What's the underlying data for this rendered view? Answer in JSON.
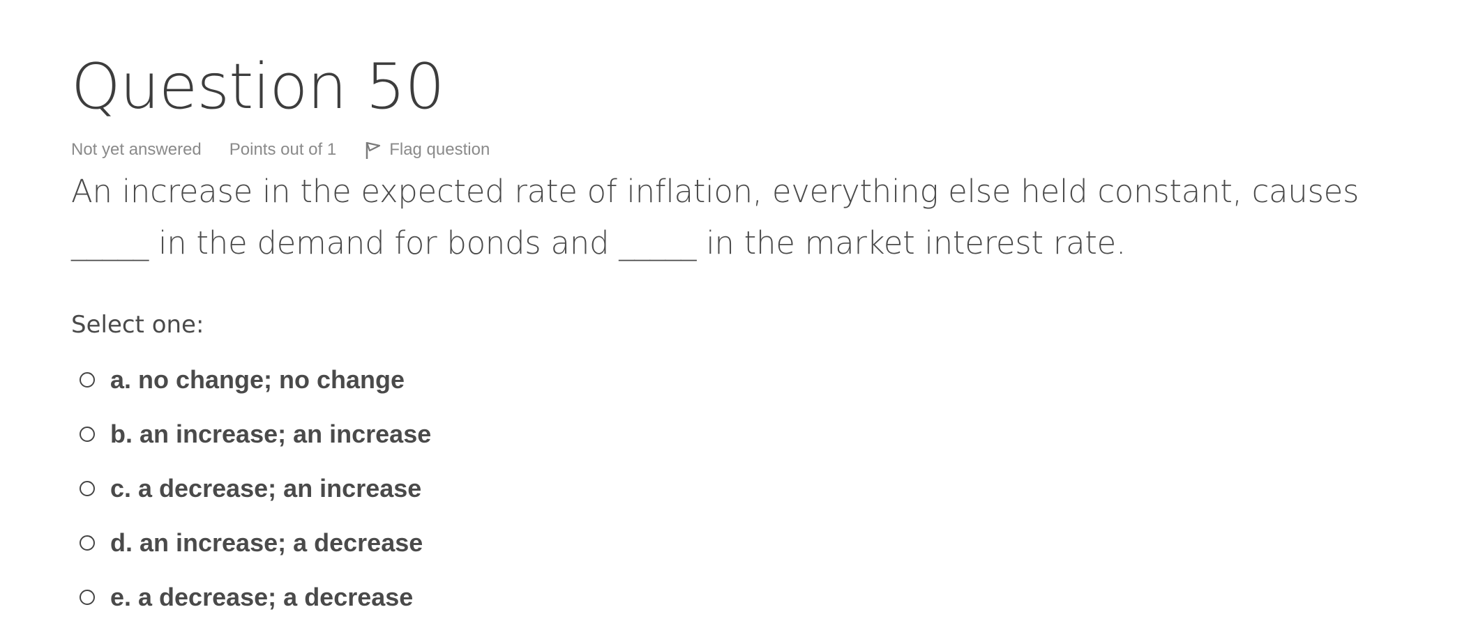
{
  "question": {
    "title": "Question 50",
    "state": "Not yet answered",
    "grade": "Points out of 1",
    "flag_label": "Flag question",
    "text": "An increase in the expected rate of inflation, everything else held constant, causes _____ in the demand for bonds and _____ in the market interest rate.",
    "prompt": "Select one:",
    "answers": [
      {
        "label": "a. no change; no change",
        "selected": false
      },
      {
        "label": "b. an increase; an increase",
        "selected": false
      },
      {
        "label": "c. a decrease; an increase",
        "selected": false
      },
      {
        "label": "d. an increase; a decrease",
        "selected": false
      },
      {
        "label": "e. a decrease; a decrease",
        "selected": false
      }
    ]
  },
  "icons": {
    "flag": "flag-icon",
    "radio": "radio-unchecked"
  },
  "colors": {
    "text": "#4a4a4a",
    "meta": "#8a8a8a",
    "background": "#ffffff"
  }
}
